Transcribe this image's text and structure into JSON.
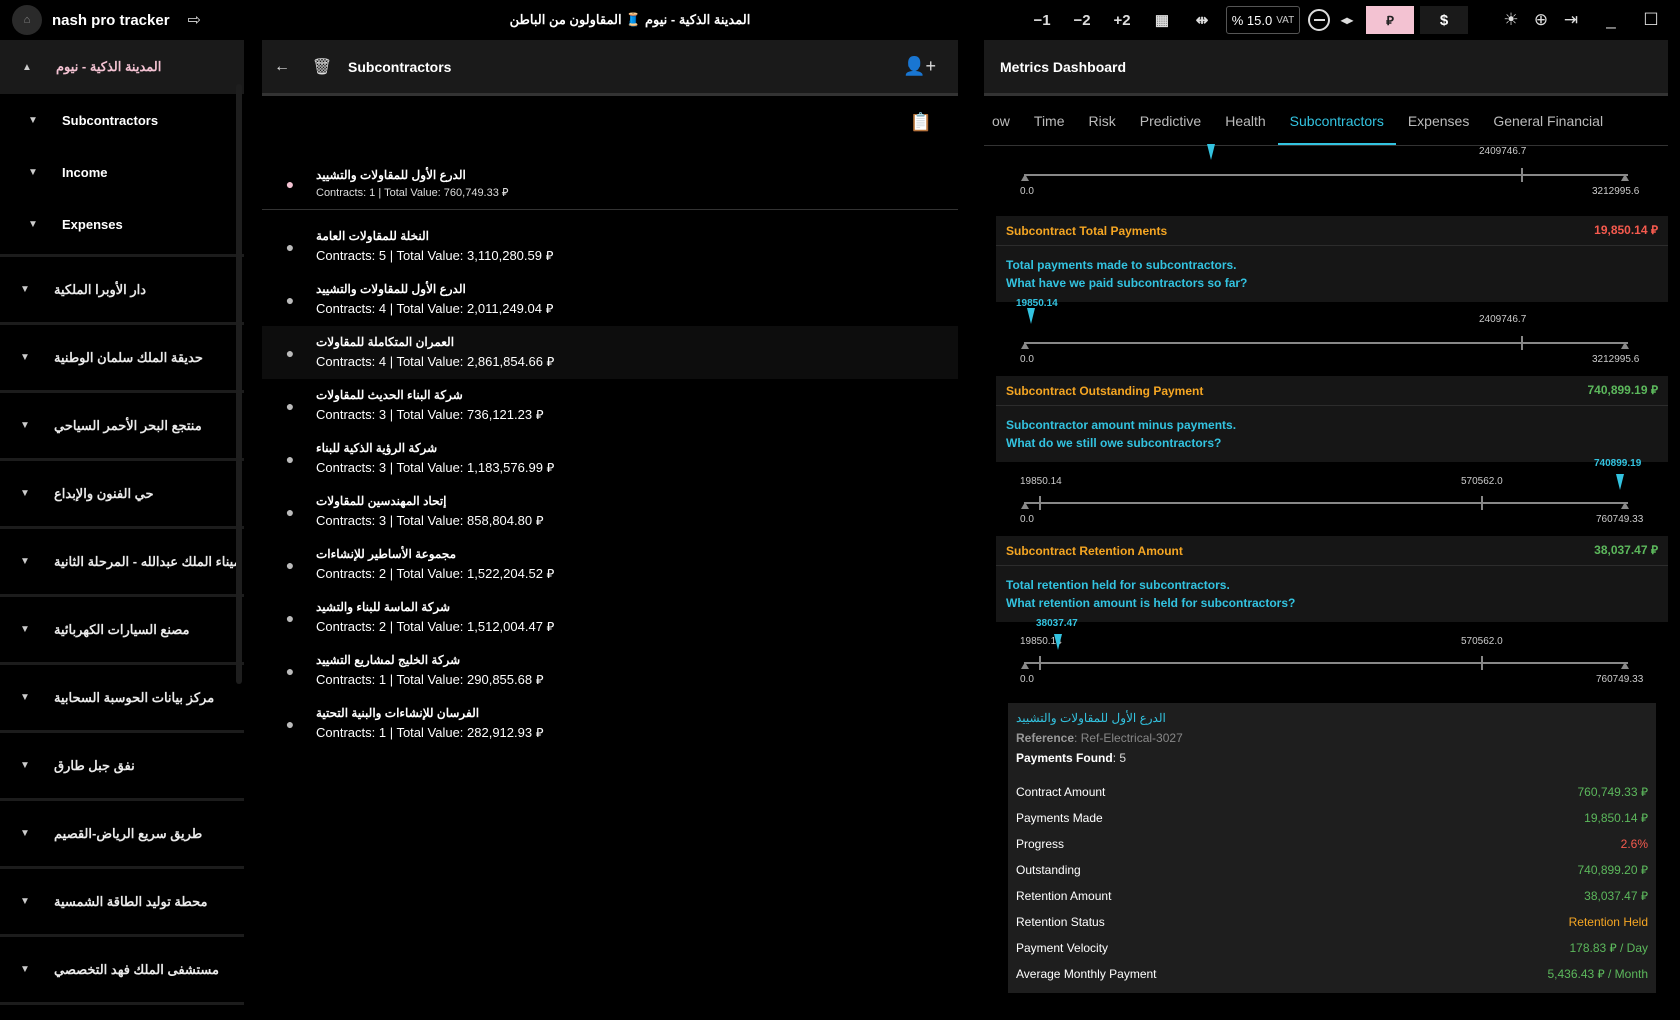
{
  "app": {
    "title": "nash pro tracker",
    "breadcrumb": "المدينة الذكية - نيوم 🧵 المقاولون من الباطن"
  },
  "toolbar": {
    "minus1": "−1",
    "minus2": "−2",
    "plus2": "+2",
    "vat_value": "% 15.0",
    "vat_label": "VAT",
    "currency_sar": "⃁",
    "currency_usd": "$"
  },
  "sidebar": {
    "active_project": "المدينة الذكية - نيوم",
    "sub_items": [
      "Subcontractors",
      "Income",
      "Expenses"
    ],
    "projects": [
      "دار الأوبرا الملكية",
      "حديقة الملك سلمان الوطنية",
      "منتجع البحر الأحمر السياحي",
      "حي الفنون والإبداع",
      "ميناء الملك عبدالله - المرحلة الثانية",
      "مصنع السيارات الكهربائية",
      "مركز بيانات الحوسبة السحابية",
      "نفق جبل طارق",
      "طريق سريع الرياض-القصيم",
      "محطة توليد الطاقة الشمسية",
      "مستشفى الملك فهد التخصصي"
    ]
  },
  "subcontractors_panel": {
    "title": "Subcontractors",
    "selected": {
      "name": "الدرع الأول للمقاولات والتشييد",
      "meta": "Contracts: 1 | Total Value: 760,749.33 ⃁"
    },
    "rows": [
      {
        "name": "النخلة للمقاولات العامة",
        "meta": "Contracts: 5 | Total Value: 3,110,280.59 ⃁"
      },
      {
        "name": "الدرع الأول للمقاولات والتشييد",
        "meta": "Contracts: 4 | Total Value: 2,011,249.04 ⃁"
      },
      {
        "name": "العمران المتكاملة للمقاولات",
        "meta": "Contracts: 4 | Total Value: 2,861,854.66 ⃁"
      },
      {
        "name": "شركة البناء الحديث للمقاولات",
        "meta": "Contracts: 3 | Total Value: 736,121.23 ⃁"
      },
      {
        "name": "شركة الرؤية الذكية للبناء",
        "meta": "Contracts: 3 | Total Value: 1,183,576.99 ⃁"
      },
      {
        "name": "إتحاد المهندسين للمقاولات",
        "meta": "Contracts: 3 | Total Value: 858,804.80 ⃁"
      },
      {
        "name": "مجموعة الأساطير للإنشاءات",
        "meta": "Contracts: 2 | Total Value: 1,522,204.52 ⃁"
      },
      {
        "name": "شركة الماسة للبناء والتشيد",
        "meta": "Contracts: 2 | Total Value: 1,512,004.47 ⃁"
      },
      {
        "name": "شركة الخليج لمشاريع التشييد",
        "meta": "Contracts: 1 | Total Value: 290,855.68 ⃁"
      },
      {
        "name": "الفرسان للإنشاءات والبنية التحتية",
        "meta": "Contracts: 1 | Total Value: 282,912.93 ⃁"
      }
    ]
  },
  "metrics": {
    "title": "Metrics Dashboard",
    "tabs": [
      "ow",
      "Time",
      "Risk",
      "Predictive",
      "Health",
      "Subcontractors",
      "Expenses",
      "General Financial"
    ],
    "active_tab": "Subcontractors",
    "scale0": {
      "min": "0.0",
      "mid": "2409746.7",
      "max": "3212995.6"
    },
    "cards": [
      {
        "title": "Subcontract Total Payments",
        "value": "19,850.14 ⃁",
        "desc1": "Total payments made to subcontractors.",
        "desc2": "What have we paid subcontractors so far?",
        "scale": {
          "marker": "19850.14",
          "min": "0.0",
          "mid": "2409746.7",
          "max": "3212995.6"
        }
      },
      {
        "title": "Subcontract Outstanding Payment",
        "value": "740,899.19 ⃁",
        "desc1": "Subcontractor amount minus payments.",
        "desc2": "What do we still owe subcontractors?",
        "scale": {
          "marker": "740899.19",
          "low": "19850.14",
          "min": "0.0",
          "mid": "570562.0",
          "max": "760749.33"
        }
      },
      {
        "title": "Subcontract Retention Amount",
        "value": "38,037.47 ⃁",
        "desc1": "Total retention held for subcontractors.",
        "desc2": "What retention amount is held for subcontractors?",
        "scale": {
          "marker": "38037.47",
          "low": "19850.14",
          "min": "0.0",
          "mid": "570562.0",
          "max": "760749.33"
        }
      }
    ],
    "detail": {
      "name": "الدرع الأول للمقاولات والتشييد",
      "ref_label": "Reference",
      "ref_value": ": Ref-Electrical-3027",
      "found_label": "Payments Found",
      "found_value": ": 5",
      "rows": [
        {
          "label": "Contract Amount",
          "value": "760,749.33 ⃁"
        },
        {
          "label": "Payments Made",
          "value": "19,850.14 ⃁"
        },
        {
          "label": "Progress",
          "value": "2.6%"
        },
        {
          "label": "Outstanding",
          "value": "740,899.20 ⃁"
        },
        {
          "label": "Retention Amount",
          "value": "38,037.47 ⃁"
        },
        {
          "label": "Retention Status",
          "value": "Retention Held"
        },
        {
          "label": "Payment Velocity",
          "value": "178.83 ⃁ / Day"
        },
        {
          "label": "Average Monthly Payment",
          "value": "5,436.43 ⃁ / Month"
        }
      ]
    }
  },
  "colors": {
    "accent": "#33c3e0",
    "pink": "#f3c2d2",
    "orange": "#f5a623",
    "green": "#5cb85c",
    "red": "#f55a4e"
  }
}
